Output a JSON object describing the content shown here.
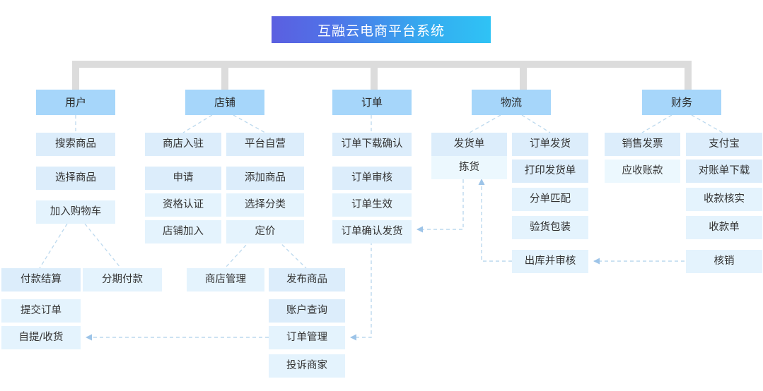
{
  "title": {
    "text": "互融云电商平台系统"
  },
  "colors": {
    "title_gradient_start": "#5b5fe0",
    "title_gradient_end": "#2fc3f5",
    "trunk": "#dcdcdc",
    "level1_box": "#a6d6fa",
    "leaf_box": "#dcedfb",
    "leaf_box_pale": "#e4f3fd",
    "connector": "#b9d7ee",
    "arrow": "#9dc4e8",
    "text": "#333333"
  },
  "branches": [
    {
      "id": "user",
      "label": "用户",
      "columns": [
        {
          "items": [
            "搜索商品",
            "选择商品",
            "加入购物车"
          ]
        }
      ],
      "sub": [
        {
          "items": [
            "付款结算",
            "提交订单",
            "自提/收货"
          ]
        },
        {
          "items": [
            "分期付款"
          ]
        }
      ]
    },
    {
      "id": "shop",
      "label": "店铺",
      "columns": [
        {
          "items": [
            "商店入驻",
            "申请",
            "资格认证",
            "店铺加入"
          ]
        },
        {
          "items": [
            "平台自营",
            "添加商品",
            "选择分类",
            "定价"
          ]
        }
      ],
      "sub": [
        {
          "items": [
            "商店管理"
          ]
        },
        {
          "items": [
            "发布商品",
            "账户查询",
            "订单管理",
            "投诉商家"
          ]
        }
      ]
    },
    {
      "id": "order",
      "label": "订单",
      "columns": [
        {
          "items": [
            "订单下载确认",
            "订单审核",
            "订单生效",
            "订单确认发货"
          ]
        }
      ],
      "sub": []
    },
    {
      "id": "logistics",
      "label": "物流",
      "columns": [
        {
          "items": [
            "发货单",
            "拣货"
          ]
        },
        {
          "items": [
            "订单发货",
            "打印发货单",
            "分单匹配",
            "验货包装",
            "出库并审核"
          ]
        }
      ],
      "sub": []
    },
    {
      "id": "finance",
      "label": "财务",
      "columns": [
        {
          "items": [
            "销售发票",
            "应收账款"
          ]
        },
        {
          "items": [
            "支付宝",
            "对账单下载",
            "收款核实",
            "收款单",
            "核销"
          ]
        }
      ],
      "sub": []
    }
  ],
  "flow_arrows": [
    {
      "from": "核销",
      "to": "出库并审核"
    },
    {
      "from": "出库并审核",
      "to": "拣货"
    },
    {
      "from": "拣货",
      "to": "订单确认发货"
    },
    {
      "from": "订单确认发货",
      "to": "订单管理"
    },
    {
      "from": "订单管理",
      "to": "自提/收货"
    }
  ]
}
